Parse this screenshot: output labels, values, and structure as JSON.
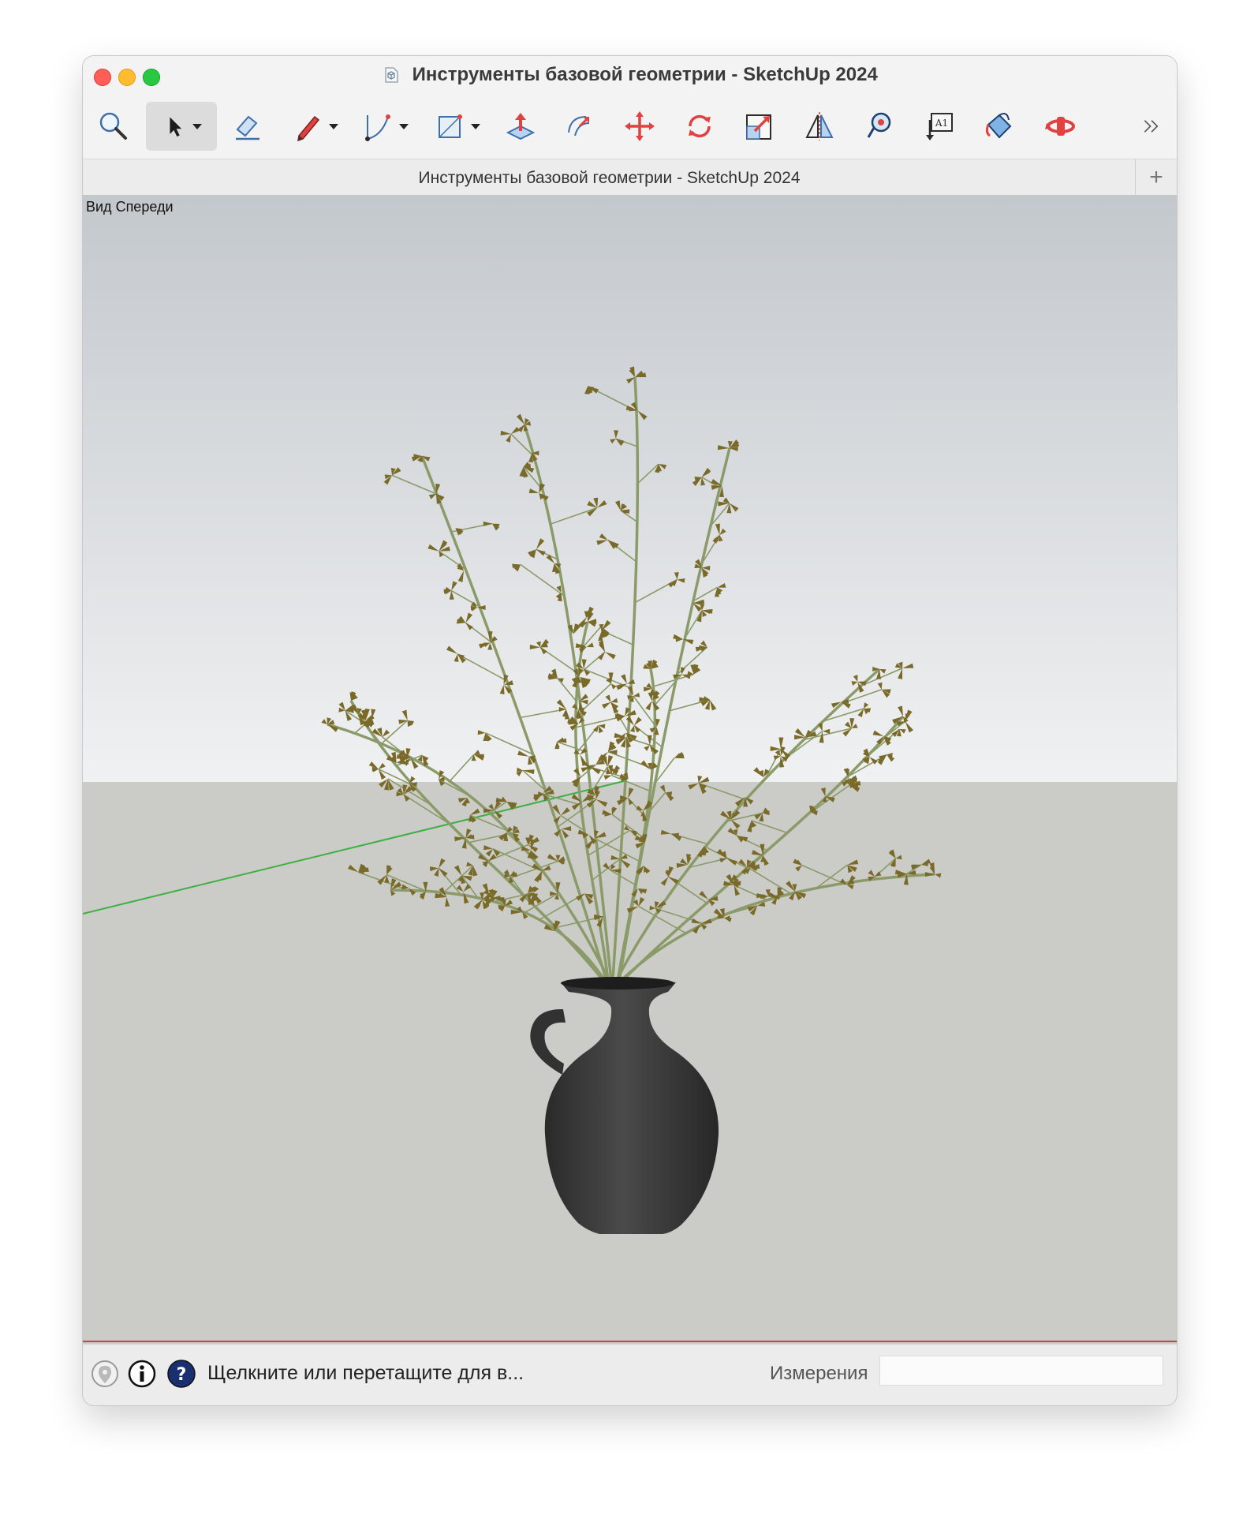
{
  "window": {
    "title": "Инструменты базовой геометрии - SketchUp 2024"
  },
  "toolbar": {
    "tools": [
      {
        "name": "zoom",
        "icon": "magnifier-icon"
      },
      {
        "name": "select",
        "icon": "arrow-cursor-icon",
        "selected": true,
        "has_menu": true
      },
      {
        "name": "eraser",
        "icon": "eraser-icon"
      },
      {
        "name": "line",
        "icon": "pencil-icon",
        "has_menu": true
      },
      {
        "name": "arc",
        "icon": "arc-icon",
        "has_menu": true
      },
      {
        "name": "shape",
        "icon": "rectangle-icon",
        "has_menu": true
      },
      {
        "name": "push-pull",
        "icon": "push-pull-icon"
      },
      {
        "name": "offset",
        "icon": "offset-icon"
      },
      {
        "name": "move",
        "icon": "move-icon"
      },
      {
        "name": "rotate",
        "icon": "rotate-icon"
      },
      {
        "name": "scale",
        "icon": "scale-icon"
      },
      {
        "name": "flip",
        "icon": "flip-icon"
      },
      {
        "name": "tape-measure",
        "icon": "tape-measure-icon"
      },
      {
        "name": "text",
        "icon": "text-label-icon"
      },
      {
        "name": "paint-bucket",
        "icon": "paint-bucket-icon"
      },
      {
        "name": "orbit",
        "icon": "orbit-icon"
      },
      {
        "name": "more",
        "icon": "chevron-double-right-icon"
      }
    ]
  },
  "tab": {
    "title": "Инструменты базовой геометрии - SketchUp 2024",
    "add_label": "+"
  },
  "viewport": {
    "scene_label": "Вид Спереди",
    "colors": {
      "sky_top": "#c3c8cd",
      "sky_bottom": "#f0f1f2",
      "ground": "#cbcbc7",
      "vase": "#3e3e3e",
      "stem": "#8a9a68",
      "leaf": "#7a6a2a",
      "green_axis": "#3cb043",
      "red_axis": "#d04040"
    }
  },
  "status": {
    "hint": "Щелкните или перетащите для в...",
    "measurements_label": "Измерения",
    "measurements_value": "",
    "icons": [
      "geolocation-icon",
      "info-icon",
      "help-icon"
    ]
  }
}
